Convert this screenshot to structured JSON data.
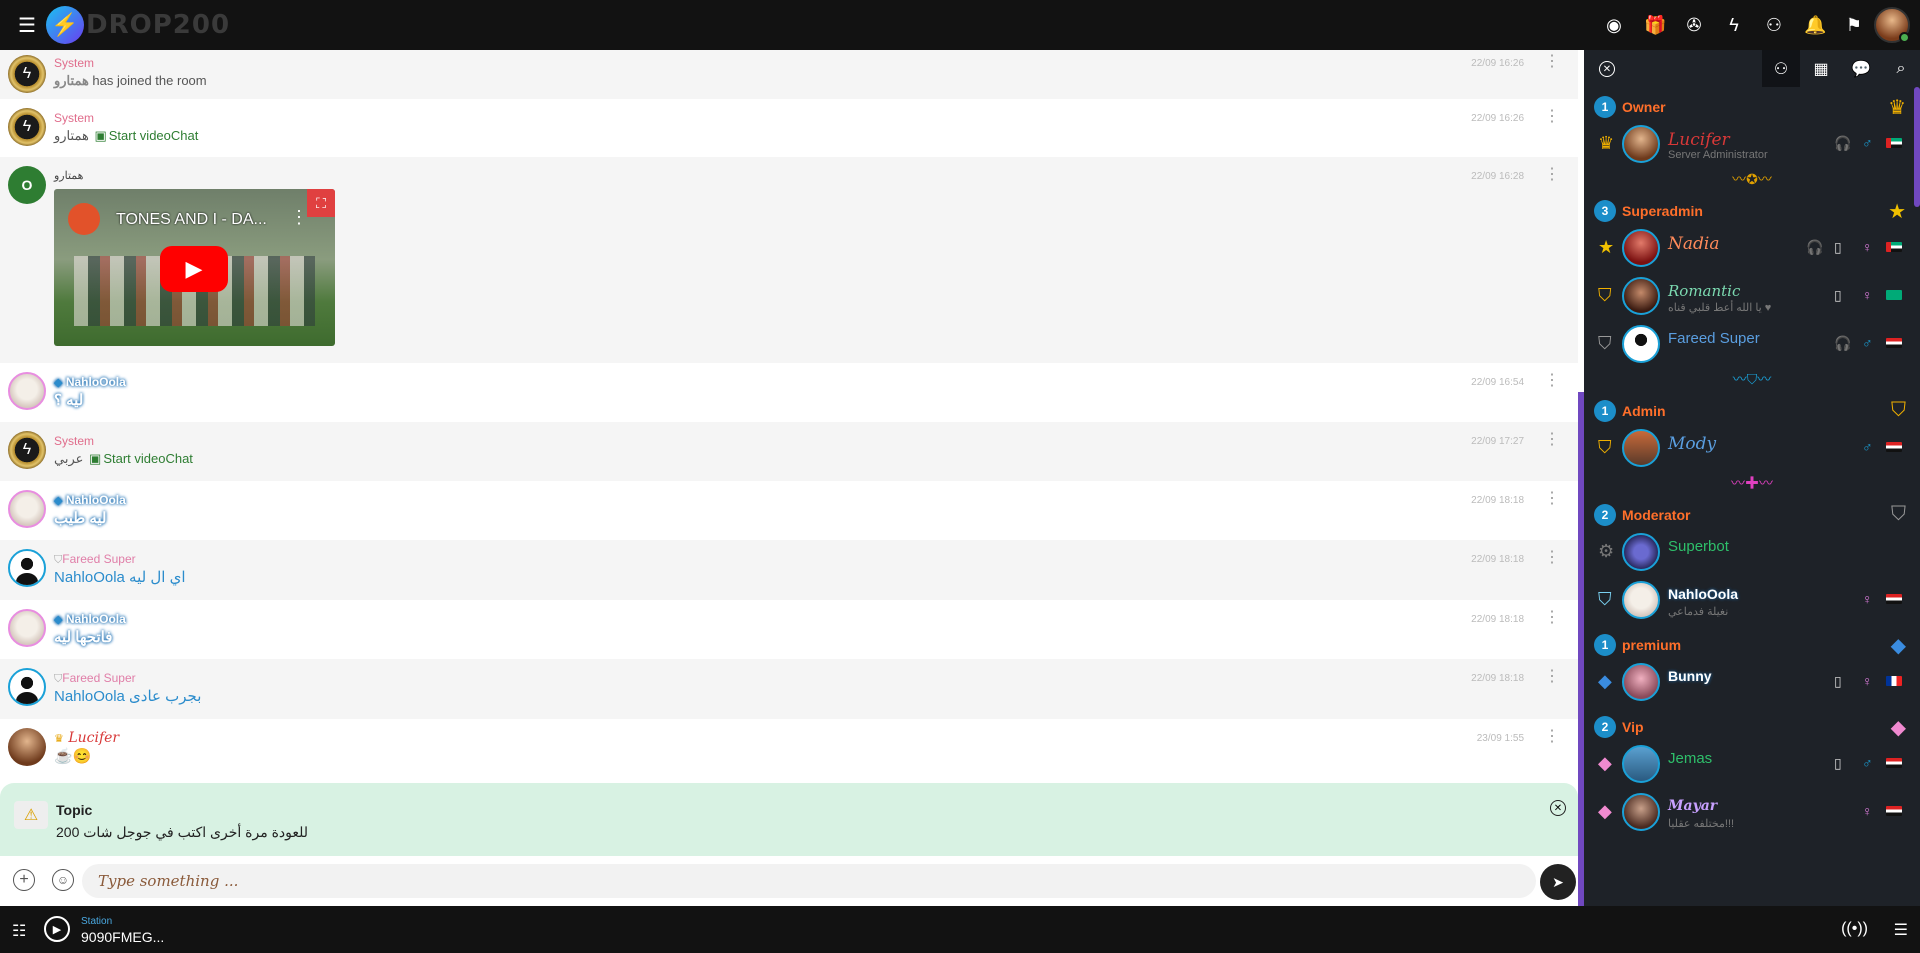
{
  "header": {
    "logo_mark": "⚡",
    "logo_text": "DROP200",
    "icons": [
      "webcam-icon",
      "gift-icon",
      "wheel-icon",
      "messenger-icon",
      "add-friend-icon",
      "bell-icon",
      "flag-icon"
    ]
  },
  "messages": [
    {
      "user": "System",
      "text_name": "همتارو",
      "text": " has joined the room",
      "time": "22/09 16:26"
    },
    {
      "user": "System",
      "text_name": "همتارو",
      "text": "Start videoChat",
      "time": "22/09 16:26"
    },
    {
      "user": "همتارو",
      "avatar_letter": "O",
      "yt_title": "TONES AND I - DA...",
      "time": "22/09 16:28"
    },
    {
      "user": "NahloOola",
      "text": "ليه ؟",
      "time": "22/09 16:54"
    },
    {
      "user": "System",
      "text_name": "عربي",
      "text": "Start videoChat",
      "time": "22/09 17:27"
    },
    {
      "user": "NahloOola",
      "text": "ليه طيب",
      "time": "22/09 18:18"
    },
    {
      "user": "Fareed Super",
      "text": "NahloOola اي ال ليه",
      "time": "22/09 18:18"
    },
    {
      "user": "NahloOola",
      "text": "فاتحها ليه",
      "time": "22/09 18:18"
    },
    {
      "user": "Fareed Super",
      "text": "NahloOola بجرب عادى",
      "time": "22/09 18:18"
    },
    {
      "user": "Lucifer",
      "text": "☕😊",
      "time": "23/09 1:55"
    }
  ],
  "topic": {
    "title": "Topic",
    "body": "للعودة مرة أخرى اكتب في جوجل شات 200"
  },
  "input": {
    "placeholder": "Type something ..."
  },
  "player": {
    "station_label": "Station",
    "station_name": "9090FMEG..."
  },
  "panel": {
    "ranks": [
      {
        "name": "Owner",
        "count": "1"
      },
      {
        "name": "Superadmin",
        "count": "3"
      },
      {
        "name": "Admin",
        "count": "1"
      },
      {
        "name": "Moderator",
        "count": "2"
      },
      {
        "name": "premium",
        "count": "1"
      },
      {
        "name": "Vip",
        "count": "2"
      }
    ],
    "users": [
      {
        "name": "Lucifer",
        "status": "Server Administrator"
      },
      {
        "name": "Nadia",
        "status": ""
      },
      {
        "name": "Romantic",
        "status": "يا الله أعط قلبي قناه ♥"
      },
      {
        "name": "Fareed Super",
        "status": ""
      },
      {
        "name": "Mody",
        "status": ""
      },
      {
        "name": "Superbot",
        "status": ""
      },
      {
        "name": "NahloOola",
        "status": "نغيلة فدماعي"
      },
      {
        "name": "Bunny",
        "status": ""
      },
      {
        "name": "Jemas",
        "status": ""
      },
      {
        "name": "Mayar",
        "status": "مختلفه عقليا!!!"
      }
    ]
  },
  "colors": {
    "accent_orange": "#ff6f2a",
    "rank_badge": "#1c8ec9",
    "topic_bg": "#d8f2e3",
    "scroll_accent": "#7048c0"
  }
}
